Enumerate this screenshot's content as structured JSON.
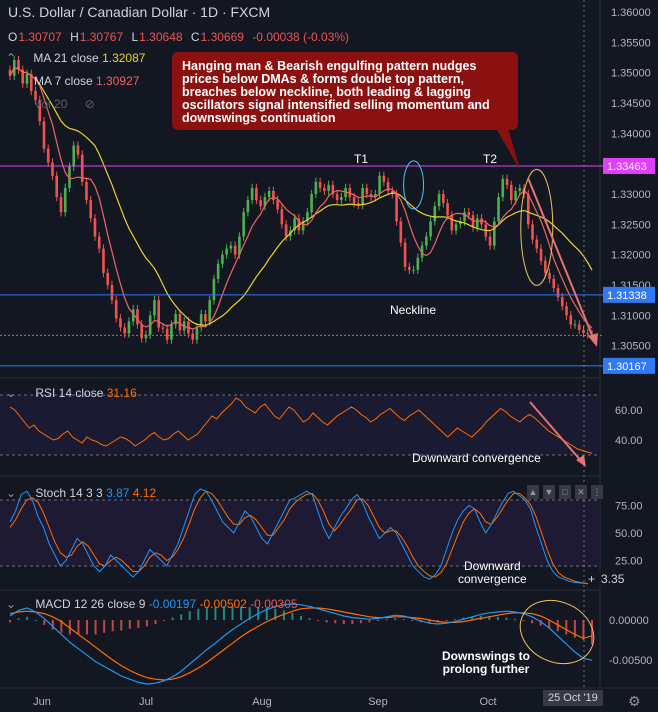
{
  "header": {
    "title": "U.S. Dollar / Canadian Dollar · 1D · FXCM",
    "ohlc": {
      "o_label": "O",
      "o": "1.30707",
      "h_label": "H",
      "h": "1.30767",
      "l_label": "L",
      "l": "1.30648",
      "c_label": "C",
      "c": "1.30669",
      "chg": "-0.00038 (-0.03%)"
    },
    "ma21": {
      "label": "MA 21 close",
      "value": "1.32087"
    },
    "ma7": {
      "label": "MA 7 close",
      "value": "1.30927"
    },
    "vol": {
      "label": "Vol 20"
    }
  },
  "annotation": "Hanging man & Bearish engulfing pattern nudges prices below DMAs & forms double top pattern, breaches below neckline, both leading & lagging oscillators signal intensified selling momentum and downswings continuation",
  "labels": {
    "t1": "T1",
    "t2": "T2",
    "neckline": "Neckline",
    "rsi_note": "Downward convergence",
    "stoch_note": "Downward\nconvergence",
    "macd_note": "Downswings to\nprolong further"
  },
  "rsi_pane": {
    "label": "RSI 14 close",
    "value": "31.16"
  },
  "stoch_pane": {
    "label": "Stoch 14 3 3",
    "k": "3.87",
    "d": "4.12",
    "cursor_value": "3.35"
  },
  "macd_pane": {
    "label": "MACD 12 26 close 9",
    "macd": "-0.00197",
    "signal": "-0.00502",
    "hist": "-0.00305"
  },
  "date_flag": "25 Oct '19",
  "colors": {
    "up": "#26a69a",
    "up_candle": "#4caf50",
    "down": "#ef5350",
    "ma21": "#e9d52b",
    "ma7": "#f06464",
    "rsi": "#ff6d00",
    "stoch_k": "#2196f3",
    "stoch_d": "#ff6d00",
    "macd": "#2196f3",
    "signal": "#ff6d00",
    "support": "#3179f5",
    "resistance": "#e040fb",
    "annotation_bg": "#8b1111"
  },
  "chart_data": {
    "type": "candlestick",
    "x_ticks": [
      "Jun",
      "Jul",
      "Aug",
      "Sep",
      "Oct"
    ],
    "price_axis": {
      "ticks": [
        "1.36000",
        "1.35500",
        "1.35000",
        "1.34500",
        "1.34000",
        "1.33500",
        "1.33000",
        "1.32500",
        "1.32000",
        "1.31500",
        "1.31000",
        "1.30500"
      ],
      "ylim": [
        1.3,
        1.361
      ],
      "markers": [
        {
          "value": "1.33463",
          "color": "#e040fb"
        },
        {
          "value": "1.31338",
          "color": "#3179f5"
        },
        {
          "value": "1.30167",
          "color": "#3179f5"
        }
      ]
    },
    "resistance": 1.33463,
    "neckline": 1.31338,
    "support": 1.30167,
    "last_close": 1.30669,
    "closes": [
      1.3495,
      1.3521,
      1.3505,
      1.3482,
      1.3498,
      1.347,
      1.3455,
      1.342,
      1.3375,
      1.3352,
      1.333,
      1.3295,
      1.327,
      1.331,
      1.3345,
      1.338,
      1.3365,
      1.332,
      1.329,
      1.326,
      1.323,
      1.321,
      1.317,
      1.315,
      1.3125,
      1.3095,
      1.308,
      1.307,
      1.309,
      1.311,
      1.3085,
      1.3062,
      1.3068,
      1.31,
      1.3125,
      1.308,
      1.3078,
      1.306,
      1.3085,
      1.3102,
      1.3075,
      1.309,
      1.307,
      1.306,
      1.308,
      1.3102,
      1.309,
      1.3125,
      1.316,
      1.3185,
      1.32,
      1.321,
      1.3215,
      1.32,
      1.323,
      1.327,
      1.329,
      1.331,
      1.329,
      1.328,
      1.3295,
      1.3305,
      1.329,
      1.3275,
      1.325,
      1.323,
      1.324,
      1.326,
      1.324,
      1.3255,
      1.327,
      1.33,
      1.332,
      1.331,
      1.3305,
      1.3315,
      1.33,
      1.329,
      1.3295,
      1.331,
      1.3295,
      1.3285,
      1.3282,
      1.331,
      1.33,
      1.3295,
      1.33,
      1.333,
      1.332,
      1.3305,
      1.33,
      1.3255,
      1.322,
      1.318,
      1.3175,
      1.3175,
      1.3195,
      1.3215,
      1.323,
      1.3255,
      1.328,
      1.33,
      1.3285,
      1.3265,
      1.324,
      1.325,
      1.3255,
      1.327,
      1.3265,
      1.3245,
      1.326,
      1.325,
      1.323,
      1.3215,
      1.3255,
      1.3295,
      1.3325,
      1.3315,
      1.329,
      1.3305,
      1.331,
      1.33,
      1.325,
      1.3225,
      1.321,
      1.319,
      1.317,
      1.316,
      1.3145,
      1.313,
      1.3115,
      1.31,
      1.3085,
      1.3085,
      1.3076,
      1.3071,
      1.3069,
      1.3067
    ],
    "rsi": {
      "axis_ticks": [
        "60.00",
        "40.00"
      ],
      "ylim": [
        20,
        80
      ],
      "values": [
        62,
        60,
        56,
        52,
        48,
        50,
        46,
        44,
        42,
        40,
        41,
        44,
        46,
        42,
        40,
        38,
        42,
        40,
        39,
        37,
        36,
        38,
        40,
        42,
        41,
        39,
        36,
        38,
        40,
        43,
        45,
        42,
        40,
        41,
        44,
        46,
        43,
        40,
        42,
        44,
        48,
        52,
        56,
        54,
        58,
        61,
        64,
        68,
        66,
        62,
        60,
        58,
        62,
        64,
        60,
        56,
        54,
        58,
        62,
        60,
        56,
        52,
        54,
        58,
        55,
        52,
        50,
        53,
        56,
        58,
        60,
        62,
        60,
        57,
        55,
        52,
        54,
        57,
        59,
        61,
        58,
        55,
        53,
        56,
        58,
        60,
        57,
        54,
        51,
        48,
        45,
        42,
        45,
        48,
        46,
        44,
        42,
        45,
        48,
        52,
        55,
        58,
        61,
        59,
        56,
        54,
        52,
        55,
        57,
        55,
        52,
        49,
        46,
        44,
        42,
        40,
        38,
        36,
        34,
        33,
        32,
        31.16
      ]
    },
    "stoch": {
      "axis_ticks": [
        "75.00",
        "50.00",
        "25.00"
      ],
      "ylim": [
        0,
        100
      ],
      "k": [
        60,
        70,
        85,
        88,
        80,
        65,
        55,
        40,
        30,
        20,
        25,
        35,
        45,
        40,
        30,
        20,
        15,
        20,
        30,
        25,
        20,
        15,
        10,
        15,
        25,
        35,
        30,
        25,
        20,
        30,
        40,
        55,
        70,
        85,
        90,
        88,
        80,
        70,
        60,
        55,
        50,
        60,
        70,
        65,
        55,
        45,
        40,
        50,
        60,
        70,
        80,
        82,
        85,
        88,
        85,
        70,
        55,
        45,
        55,
        65,
        72,
        80,
        85,
        78,
        65,
        55,
        45,
        50,
        55,
        50,
        40,
        30,
        20,
        15,
        10,
        8,
        12,
        20,
        35,
        50,
        62,
        70,
        75,
        72,
        60,
        50,
        58,
        68,
        78,
        86,
        88,
        84,
        80,
        72,
        55,
        40,
        25,
        15,
        10,
        8,
        6,
        5,
        4.5,
        4,
        3.87
      ],
      "d": [
        55,
        62,
        72,
        80,
        82,
        78,
        68,
        55,
        42,
        32,
        28,
        30,
        38,
        42,
        38,
        30,
        22,
        20,
        25,
        28,
        25,
        20,
        15,
        15,
        20,
        28,
        32,
        30,
        25,
        28,
        35,
        45,
        58,
        72,
        82,
        88,
        86,
        80,
        72,
        64,
        58,
        58,
        64,
        66,
        62,
        55,
        48,
        48,
        55,
        62,
        72,
        78,
        82,
        85,
        86,
        80,
        70,
        58,
        52,
        58,
        65,
        72,
        80,
        81,
        75,
        65,
        55,
        50,
        52,
        52,
        46,
        38,
        28,
        20,
        15,
        11,
        10,
        14,
        22,
        35,
        48,
        60,
        68,
        72,
        68,
        60,
        58,
        64,
        72,
        80,
        86,
        86,
        82,
        76,
        65,
        50,
        35,
        22,
        14,
        10,
        8,
        6,
        5,
        4.3,
        4.12
      ]
    },
    "macd": {
      "axis_ticks": [
        "0.00000",
        "-0.00500"
      ],
      "ylim": [
        -0.0085,
        0.0035
      ],
      "macd": [
        0.0005,
        0.0012,
        0.0015,
        0.001,
        0.0002,
        -0.0008,
        -0.0018,
        -0.0028,
        -0.0036,
        -0.0044,
        -0.0052,
        -0.0058,
        -0.0064,
        -0.007,
        -0.0074,
        -0.0078,
        -0.008,
        -0.0079,
        -0.0076,
        -0.0071,
        -0.0064,
        -0.0055,
        -0.0046,
        -0.0037,
        -0.0029,
        -0.002,
        -0.0012,
        -0.0005,
        0.0002,
        0.0008,
        0.0013,
        0.0017,
        0.0019,
        0.002,
        0.0019,
        0.0017,
        0.0014,
        0.0011,
        0.0008,
        0.0005,
        0.0003,
        0.0002,
        0.0001,
        0.0002,
        0.0004,
        0.0006,
        0.0005,
        0.0002,
        -0.0001,
        -0.0004,
        -0.0005,
        -0.0004,
        -0.0002,
        0.0001,
        0.0004,
        0.0007,
        0.0009,
        0.001,
        0.0011,
        0.001,
        0.0008,
        0.0004,
        -0.0002,
        -0.001,
        -0.002,
        -0.003,
        -0.004,
        -0.0048,
        -0.00502
      ],
      "signal": [
        0.0008,
        0.001,
        0.0011,
        0.001,
        0.0008,
        0.0004,
        -0.0002,
        -0.001,
        -0.0018,
        -0.0026,
        -0.0034,
        -0.0042,
        -0.005,
        -0.0057,
        -0.0063,
        -0.0068,
        -0.0072,
        -0.0074,
        -0.0075,
        -0.0074,
        -0.0071,
        -0.0066,
        -0.006,
        -0.0053,
        -0.0045,
        -0.0037,
        -0.0029,
        -0.0021,
        -0.0014,
        -0.0008,
        -0.0002,
        0.0003,
        0.0007,
        0.0011,
        0.0014,
        0.0015,
        0.0015,
        0.0014,
        0.0012,
        0.001,
        0.0008,
        0.0006,
        0.0004,
        0.0003,
        0.0003,
        0.0004,
        0.0004,
        0.0003,
        0.0002,
        0.0,
        -0.0002,
        -0.0003,
        -0.0003,
        -0.0002,
        0.0,
        0.0002,
        0.0004,
        0.0006,
        0.0008,
        0.0009,
        0.0009,
        0.0008,
        0.0005,
        0.0,
        -0.0006,
        -0.0012,
        -0.0018,
        -0.0023,
        -0.00197
      ]
    }
  }
}
